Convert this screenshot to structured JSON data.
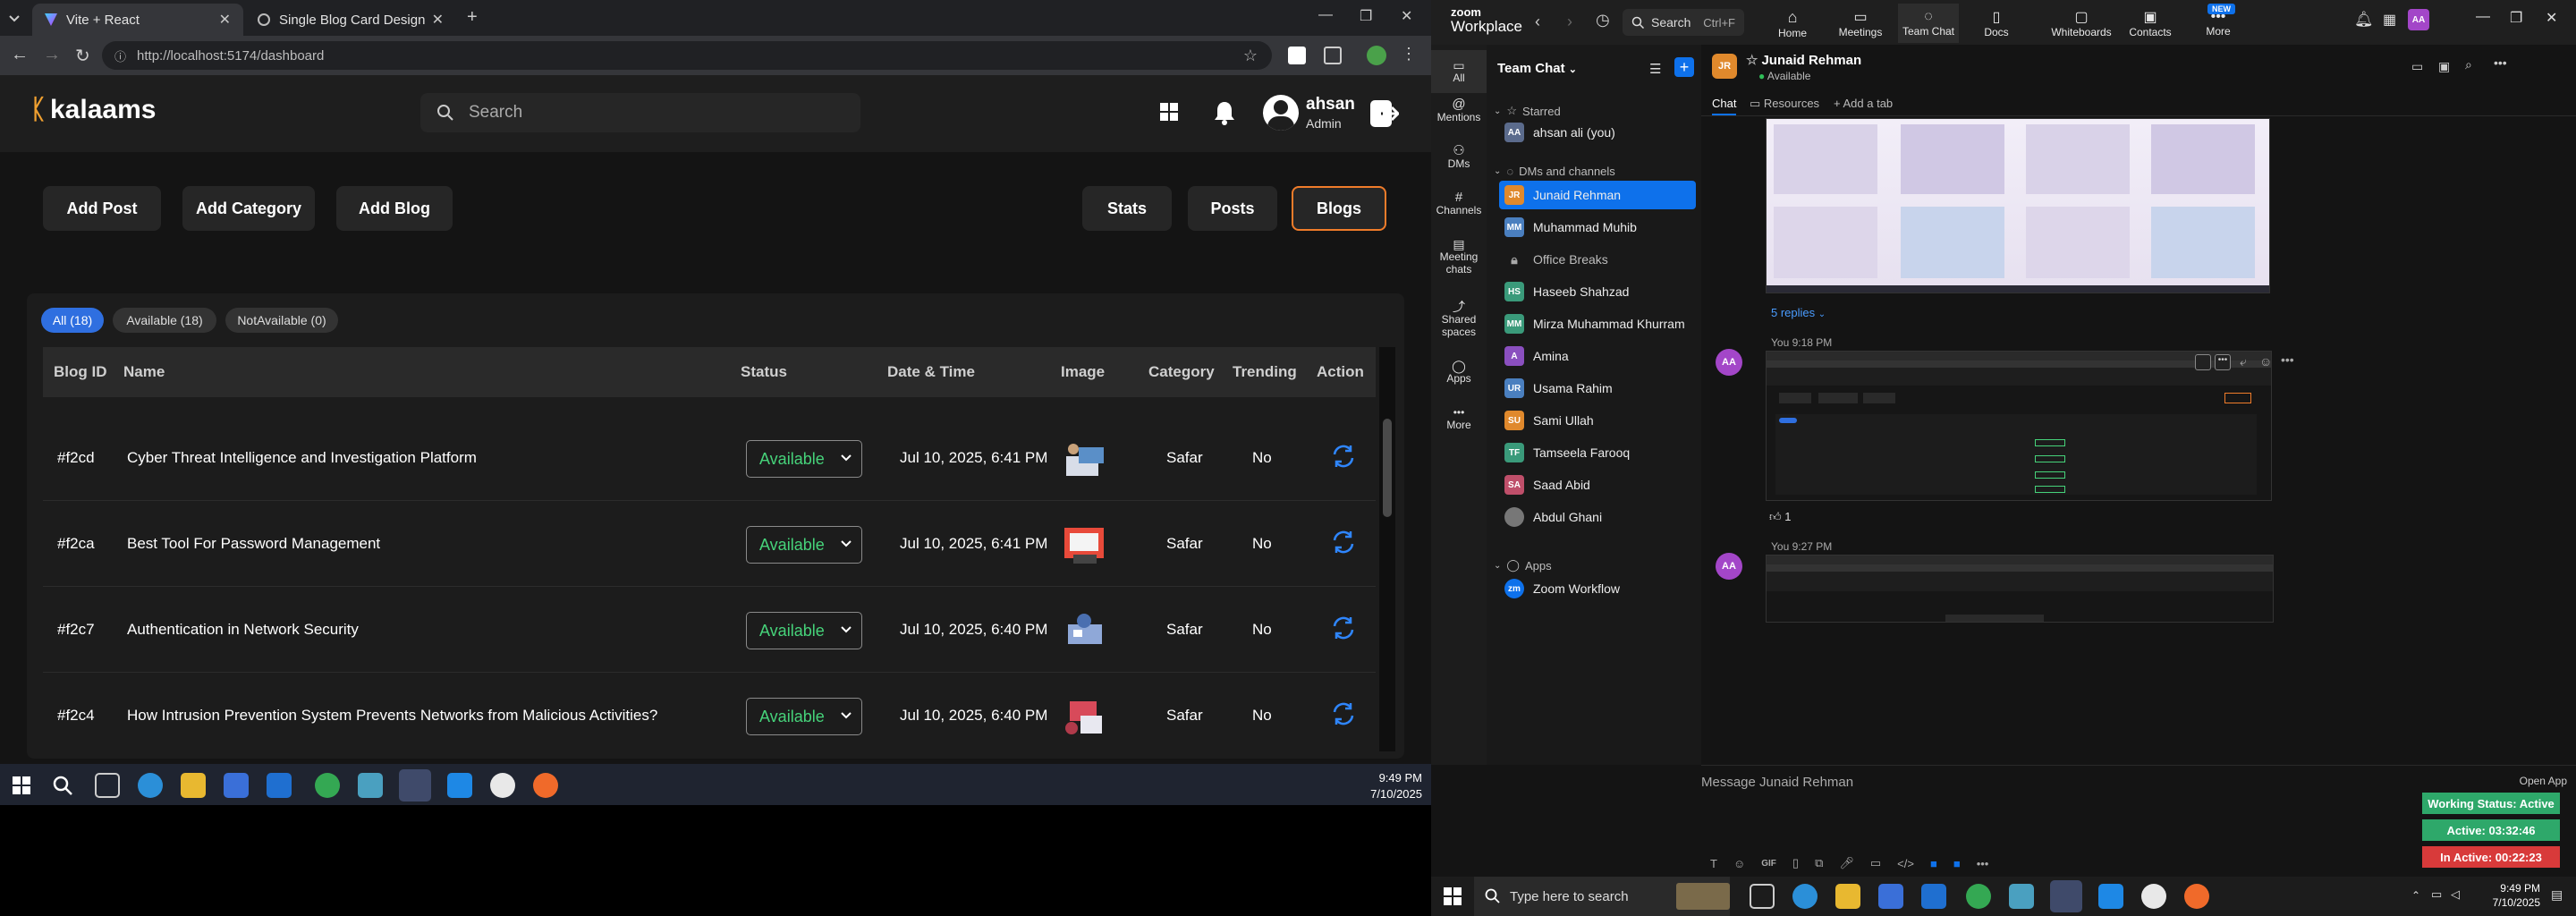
{
  "browser": {
    "tabs": [
      {
        "title": "Vite + React"
      },
      {
        "title": "Single Blog Card Design"
      }
    ],
    "url": "http://localhost:5174/dashboard"
  },
  "app": {
    "logo": "kalaams",
    "search_placeholder": "Search",
    "user": {
      "name": "ahsan",
      "role": "Admin"
    },
    "toolbar": {
      "add_post": "Add Post",
      "add_category": "Add Category",
      "add_blog": "Add Blog",
      "stats": "Stats",
      "posts": "Posts",
      "blogs": "Blogs"
    },
    "filters": [
      {
        "label": "All (18)"
      },
      {
        "label": "Available (18)"
      },
      {
        "label": "NotAvailable (0)"
      }
    ],
    "columns": [
      "Blog ID",
      "Name",
      "Status",
      "Date & Time",
      "Image",
      "Category",
      "Trending",
      "Action"
    ],
    "rows": [
      {
        "id": "#f2cd",
        "name": "Cyber Threat Intelligence and Investigation Platform",
        "status": "Available",
        "date": "Jul 10, 2025, 6:41 PM",
        "category": "Safar",
        "trending": "No"
      },
      {
        "id": "#f2ca",
        "name": "Best Tool For Password Management",
        "status": "Available",
        "date": "Jul 10, 2025, 6:41 PM",
        "category": "Safar",
        "trending": "No"
      },
      {
        "id": "#f2c7",
        "name": "Authentication in Network Security",
        "status": "Available",
        "date": "Jul 10, 2025, 6:40 PM",
        "category": "Safar",
        "trending": "No"
      },
      {
        "id": "#f2c4",
        "name": "How Intrusion Prevention System Prevents Networks from Malicious Activities?",
        "status": "Available",
        "date": "Jul 10, 2025, 6:40 PM",
        "category": "Safar",
        "trending": "No"
      }
    ]
  },
  "taskbar_left": {
    "time": "9:49 PM",
    "date": "7/10/2025"
  },
  "zoom": {
    "brand_top": "zoom",
    "brand_bottom": "Workplace",
    "search_label": "Search",
    "search_shortcut": "Ctrl+F",
    "nav": [
      {
        "label": "Home"
      },
      {
        "label": "Meetings"
      },
      {
        "label": "Team Chat"
      },
      {
        "label": "Docs"
      },
      {
        "label": "Whiteboards"
      },
      {
        "label": "Contacts"
      },
      {
        "label": "More"
      }
    ],
    "new_badge": "NEW",
    "account_initials": "AA",
    "side": [
      {
        "label": "All"
      },
      {
        "label": "Mentions"
      },
      {
        "label": "DMs"
      },
      {
        "label": "Channels"
      },
      {
        "label": "Meeting chats"
      },
      {
        "label": "Shared spaces"
      },
      {
        "label": "Apps"
      },
      {
        "label": "More"
      }
    ],
    "list_title": "Team Chat",
    "sections": {
      "starred": "Starred",
      "dms": "DMs and channels",
      "apps": "Apps"
    },
    "starred": [
      {
        "initials": "AA",
        "name": "ahsan ali (you)",
        "color": "#5b6b8c"
      }
    ],
    "contacts": [
      {
        "initials": "JR",
        "name": "Junaid Rehman",
        "color": "#e0892c"
      },
      {
        "initials": "MM",
        "name": "Muhammad Muhib",
        "color": "#4a7fbf"
      },
      {
        "initials": "",
        "name": "Office Breaks",
        "color": "#555555"
      },
      {
        "initials": "HS",
        "name": "Haseeb Shahzad",
        "color": "#3a9a7a"
      },
      {
        "initials": "MM",
        "name": "Mirza Muhammad Khurram",
        "color": "#3a9a7a"
      },
      {
        "initials": "A",
        "name": "Amina",
        "color": "#8a4fbf"
      },
      {
        "initials": "UR",
        "name": "Usama Rahim",
        "color": "#4a7fbf"
      },
      {
        "initials": "SU",
        "name": "Sami Ullah",
        "color": "#e0892c"
      },
      {
        "initials": "TF",
        "name": "Tamseela Farooq",
        "color": "#3a9a7a"
      },
      {
        "initials": "SA",
        "name": "Saad Abid",
        "color": "#bf4f6a"
      },
      {
        "initials": "",
        "name": "Abdul Ghani",
        "color": "#777777"
      }
    ],
    "apps": [
      {
        "name": "Zoom Workflow",
        "color": "#0e71eb"
      }
    ],
    "chat": {
      "contact_initials": "JR",
      "contact_name": "Junaid Rehman",
      "contact_status": "Available",
      "tabs": {
        "chat": "Chat",
        "resources": "Resources",
        "add_tab": "Add a tab"
      },
      "replies": "5 replies",
      "messages": [
        {
          "sender": "You",
          "time": "9:18 PM",
          "initials": "AA"
        },
        {
          "sender": "You",
          "time": "9:27 PM",
          "initials": "AA"
        }
      ],
      "reaction_count": "1",
      "input_placeholder": "Message Junaid Rehman",
      "open_app": "Open App"
    },
    "working": {
      "status": "Working Status: Active",
      "active": "Active: 03:32:46",
      "inactive": "In Active: 00:22:23"
    },
    "taskbar": {
      "search_placeholder": "Type here to search",
      "time": "9:49 PM",
      "date": "7/10/2025"
    }
  }
}
